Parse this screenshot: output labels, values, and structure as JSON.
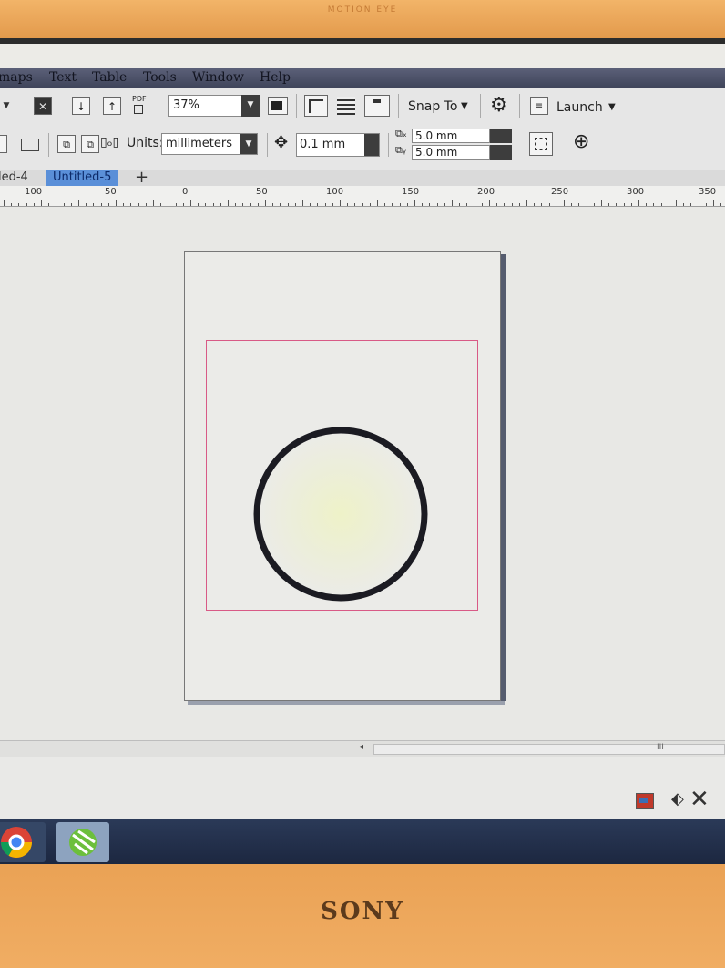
{
  "bezel": {
    "camera_label": "MOTION EYE",
    "brand": "SONY"
  },
  "menu": {
    "items": [
      "maps",
      "Text",
      "Table",
      "Tools",
      "Window",
      "Help"
    ]
  },
  "toolbar": {
    "zoom_value": "37%",
    "snap_label": "Snap To",
    "launch_label": "Launch",
    "pdf_label": "PDF"
  },
  "property_bar": {
    "units_label": "Units:",
    "units_value": "millimeters",
    "nudge_value": "0.1 mm",
    "duplicate_x": "5.0 mm",
    "duplicate_y": "5.0 mm"
  },
  "tabs": [
    {
      "label": "led-4",
      "active": false
    },
    {
      "label": "Untitled-5",
      "active": true
    }
  ],
  "ruler": {
    "labels": [
      "100",
      "50",
      "0",
      "50",
      "100",
      "150",
      "200",
      "250",
      "300",
      "350"
    ]
  },
  "canvas": {
    "shape": "circle",
    "stroke_color": "#1b1b22",
    "margin_color": "#d85a86"
  },
  "status": {
    "scroll_marker": "III"
  }
}
